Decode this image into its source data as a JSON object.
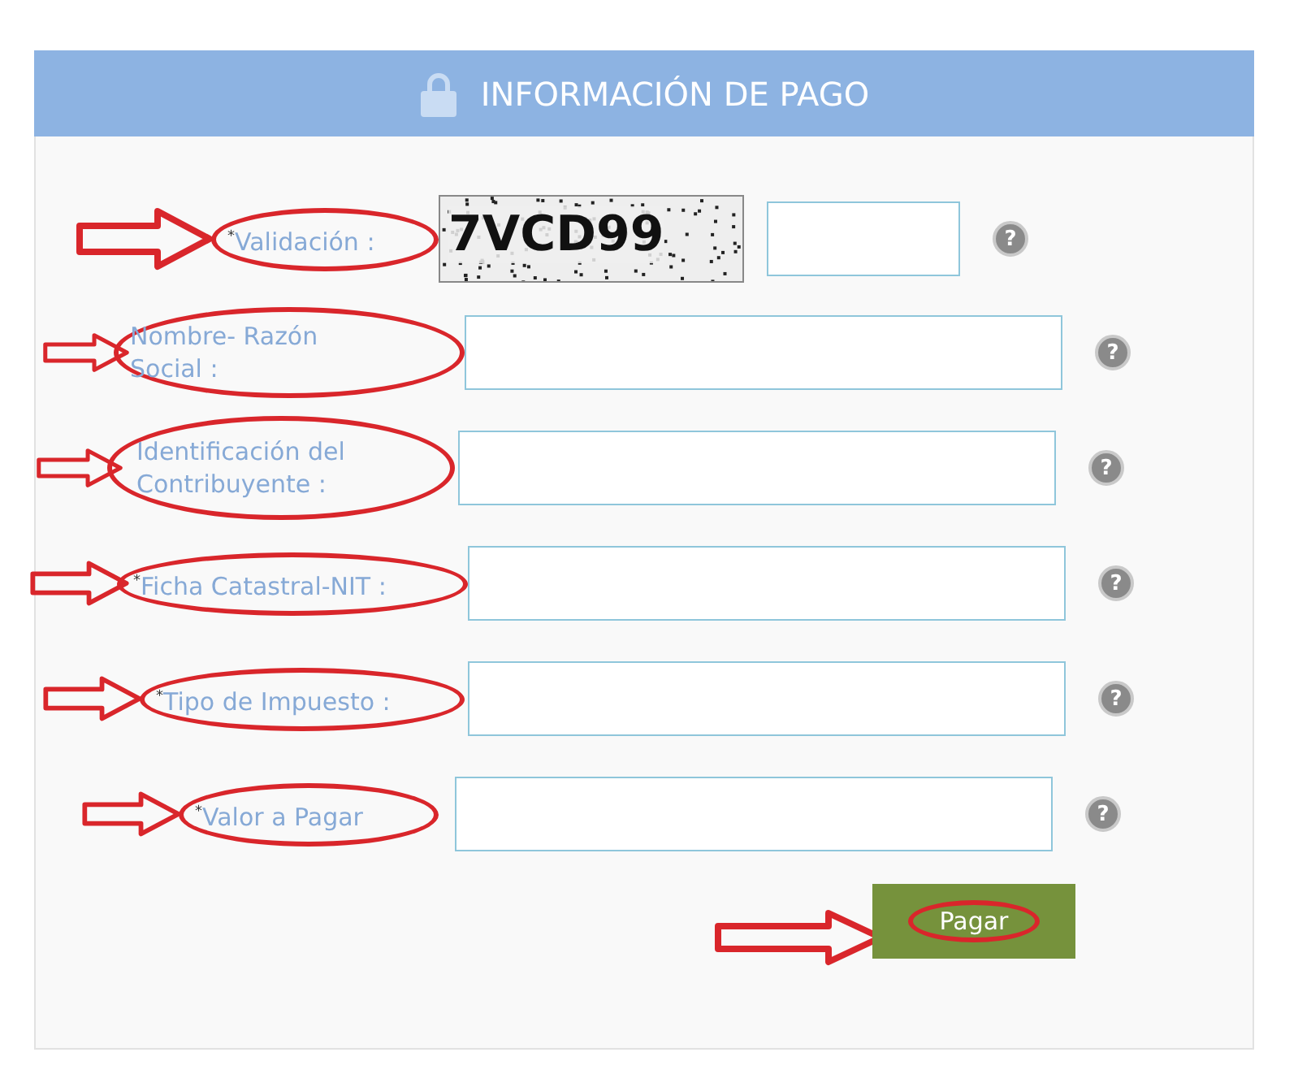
{
  "header": {
    "title": "INFORMACIÓN DE PAGO"
  },
  "fields": [
    {
      "kind": "captcha",
      "required_mark": "*",
      "label": "Validación :",
      "captcha": "7VCD99",
      "help": "?"
    },
    {
      "kind": "text",
      "label": "Nombre- Razón Social :",
      "help": "?"
    },
    {
      "kind": "text",
      "label": "Identificación del Contribuyente :",
      "help": "?"
    },
    {
      "kind": "text",
      "required_mark": "*",
      "label": "Ficha Catastral-NIT :",
      "help": "?"
    },
    {
      "kind": "text",
      "required_mark": "*",
      "label": "Tipo de Impuesto :",
      "help": "?"
    },
    {
      "kind": "text",
      "required_mark": "*",
      "label": "Valor a Pagar",
      "help": "?"
    }
  ],
  "submit": {
    "label": "Pagar"
  }
}
